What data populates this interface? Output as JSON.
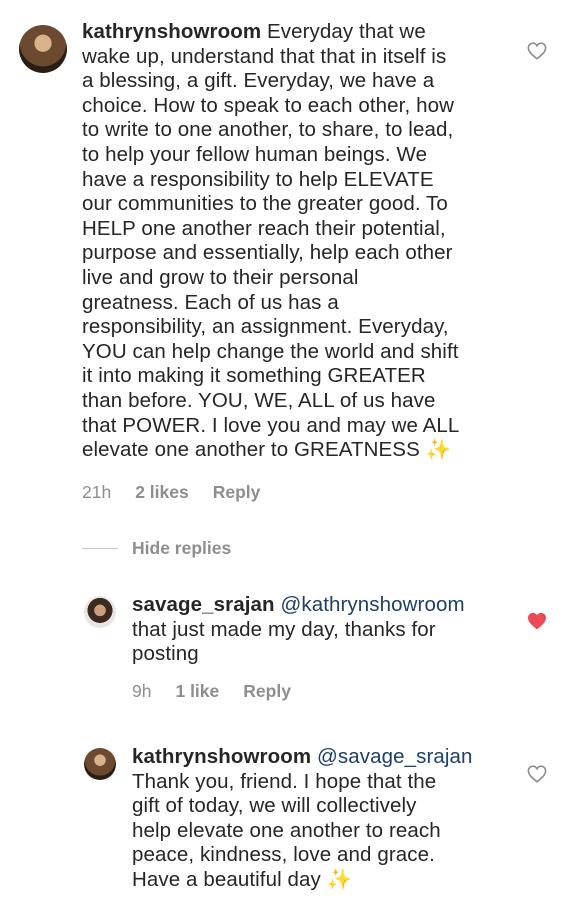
{
  "comments": [
    {
      "username": "kathrynshowroom",
      "body": " Everyday that we\nwake up, understand that that in itself is\na blessing, a gift. Everyday, we have a\nchoice. How to speak to each other, how\nto write to one another, to share, to lead,\nto help your fellow human beings. We\nhave a responsibility to help ELEVATE\nour communities to the greater good. To\nHELP one another reach their potential,\npurpose and essentially, help each other\nlive and grow to their personal\ngreatness. Each of us has a\nresponsibility, an assignment. Everyday,\nYOU can help change the world and shift\nit into making it something GREATER\nthan before. YOU, WE, ALL of us have\nthat POWER. I love you and may we ALL\nelevate one another to GREATNESS ✨",
      "time": "21h",
      "likes": "2 likes",
      "reply": "Reply",
      "liked": false
    },
    {
      "username": "savage_srajan",
      "mention": "@kathrynshowroom",
      "body": "that just made my day, thanks for\nposting",
      "time": "9h",
      "likes": "1 like",
      "reply": "Reply",
      "liked": true
    },
    {
      "username": "kathrynshowroom",
      "mention": "@savage_srajan",
      "body": "Thank you, friend. I hope that the\ngift of  today, we will collectively\nhelp elevate one another to reach\npeace, kindness, love and grace.\nHave a beautiful day ✨",
      "liked": false
    }
  ],
  "hide_replies": "Hide replies",
  "colors": {
    "text": "#262626",
    "muted": "#8e8e8e",
    "heart_liked": "#ed4956",
    "mention": "#1f3f6b"
  }
}
